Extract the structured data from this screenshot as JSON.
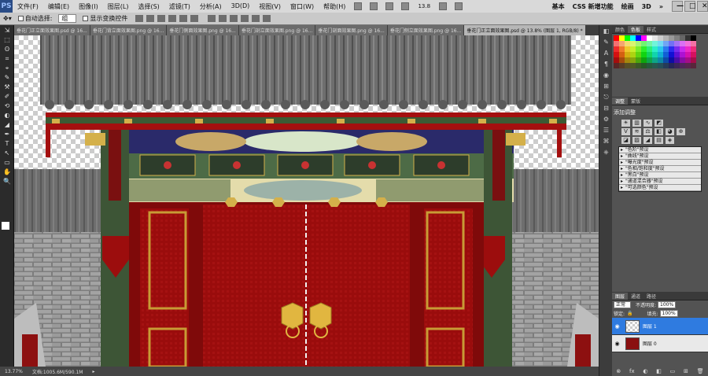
{
  "app": {
    "logo": "PS"
  },
  "menu": [
    "文件(F)",
    "编辑(E)",
    "图像(I)",
    "图层(L)",
    "选择(S)",
    "滤镜(T)",
    "分析(A)",
    "3D(D)",
    "视图(V)",
    "窗口(W)",
    "帮助(H)"
  ],
  "zoom_level": "13.8",
  "workspaces": [
    "基本",
    "CSS 新增功能",
    "绘画",
    "3D"
  ],
  "window_controls": [
    "—",
    "□",
    "✕"
  ],
  "options": {
    "auto_select_label": "自动选择:",
    "auto_select_value": "组",
    "transform_label": "显示变换控件"
  },
  "tools": [
    "⇲",
    "⬚",
    "ʘ",
    "⌗",
    "⌖",
    "✎",
    "⚒",
    "✐",
    "⟲",
    "◐",
    "◢",
    "✒",
    "T",
    "↖",
    "▭",
    "✋",
    "🔍"
  ],
  "swatch_colors": {
    "fg": "#ffffff",
    "bg": "#000000"
  },
  "doc_tabs": [
    "垂花门正立面效果图.psd @ 16...",
    "垂花门背立面效果图.png @ 16...",
    "垂花门侧面效果图.png @ 16...",
    "垂花门剖立面效果图.png @ 16...",
    "垂花门剖面效果图.png @ 16...",
    "垂花门侧立面效果图.png @ 16...",
    "垂花门正立面效果图.psd @ 13.8% (图层 1, RGB/8) *"
  ],
  "active_tab": 6,
  "status": {
    "zoom": "13.77%",
    "doc": "文档:1005.6M/590.1M"
  },
  "panel_strip_icons": [
    "◧",
    "✎",
    "A",
    "¶",
    "◉",
    "⊞",
    "⎋",
    "⊟",
    "⚙",
    "☰",
    "⌘",
    "⎈"
  ],
  "panels": {
    "color_tabs": [
      "颜色",
      "色板",
      "样式"
    ],
    "adj_tabs": [
      "调整",
      "蒙版"
    ],
    "adj_title": "添加调整",
    "presets": [
      "\"色阶\"预设",
      "\"曲线\"预设",
      "\"曝光度\"预设",
      "\"色相/饱和度\"预设",
      "\"黑白\"预设",
      "\"通道混合器\"预设",
      "\"可选颜色\"预设"
    ],
    "layer_tabs": [
      "图层",
      "通道",
      "路径"
    ],
    "blend_mode": "正常",
    "opacity_label": "不透明度:",
    "opacity": "100%",
    "lock_label": "锁定:",
    "fill_label": "填充:",
    "fill": "100%",
    "layers": [
      {
        "name": "图层 1",
        "active": true
      },
      {
        "name": "图层 0",
        "active": false
      }
    ],
    "layer_footer": [
      "⊗",
      "fx",
      "◐",
      "◧",
      "▭",
      "⊞",
      "🗑"
    ]
  }
}
